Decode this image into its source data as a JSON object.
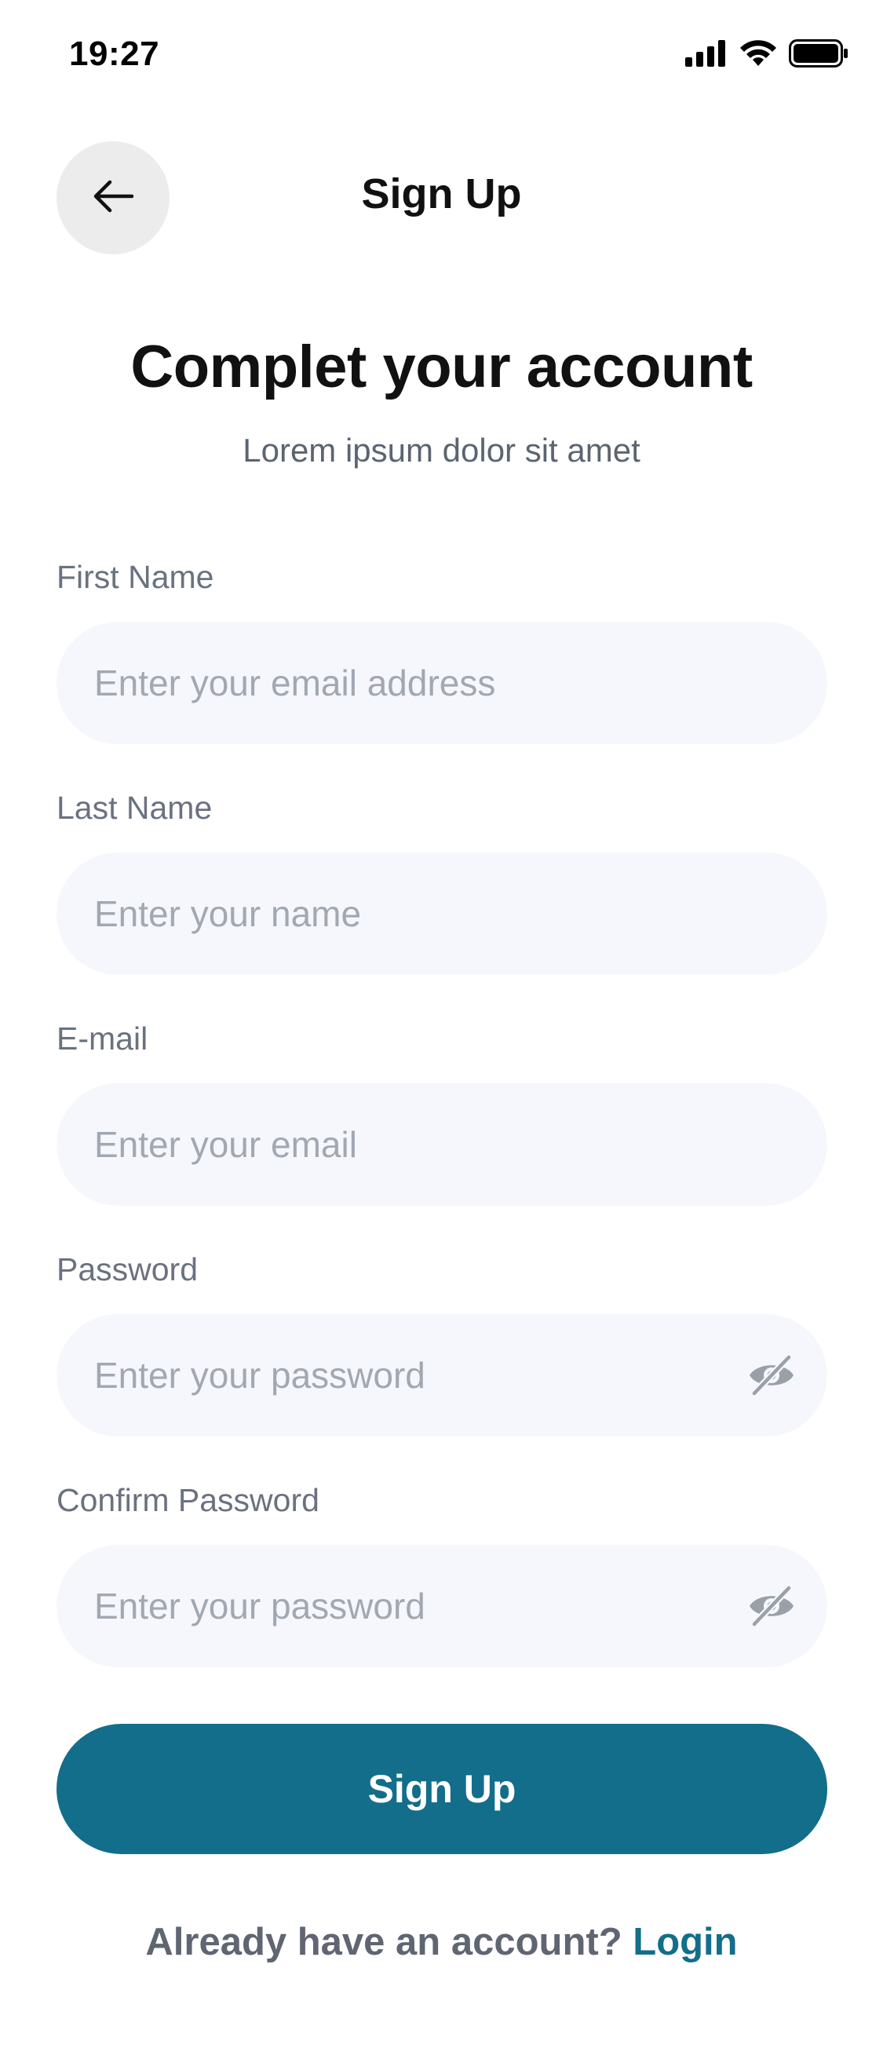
{
  "status_bar": {
    "time": "19:27",
    "icons": [
      "cellular-signal-icon",
      "wifi-icon",
      "battery-icon"
    ]
  },
  "header": {
    "back_icon": "arrow-left-icon",
    "title": "Sign Up"
  },
  "intro": {
    "headline": "Complet your account",
    "subheadline": "Lorem ipsum dolor sit amet"
  },
  "form": {
    "first_name": {
      "label": "First Name",
      "placeholder": "Enter your email address",
      "value": ""
    },
    "last_name": {
      "label": "Last Name",
      "placeholder": "Enter your name",
      "value": ""
    },
    "email": {
      "label": "E-mail",
      "placeholder": "Enter your email",
      "value": ""
    },
    "password": {
      "label": "Password",
      "placeholder": "Enter your password",
      "value": "",
      "toggle_icon": "eye-off-icon"
    },
    "confirm_password": {
      "label": "Confirm Password",
      "placeholder": "Enter your password",
      "value": "",
      "toggle_icon": "eye-off-icon"
    },
    "submit_label": "Sign Up"
  },
  "footer": {
    "prompt": "Already have an account?",
    "login_label": "Login"
  },
  "colors": {
    "primary": "#126e8a",
    "field_background": "#f6f7fc",
    "back_button_background": "#ececec",
    "placeholder": "#a2a8b2",
    "label": "#6a7280"
  }
}
